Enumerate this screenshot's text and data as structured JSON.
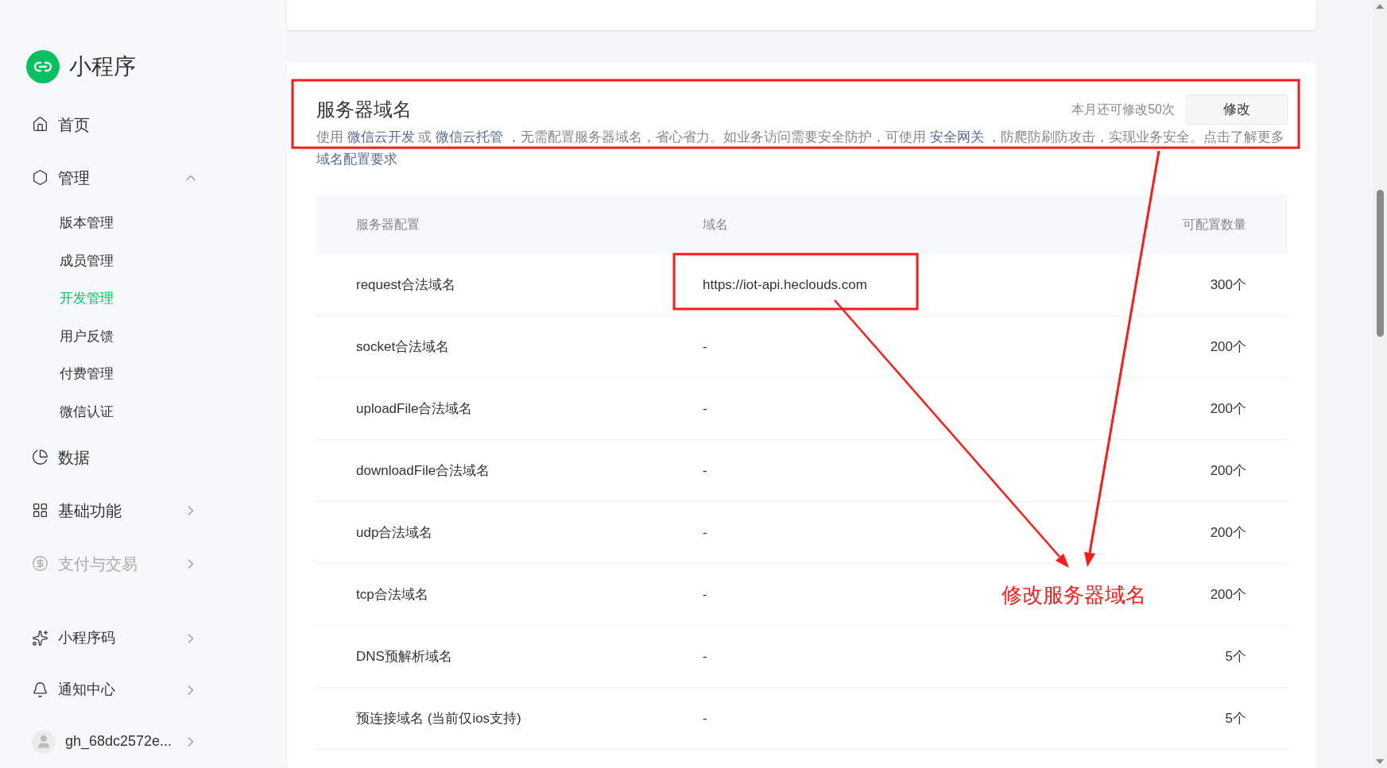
{
  "sidebar": {
    "logo": {
      "title": "小程序"
    },
    "menu": [
      {
        "kind": "link",
        "label": "首页",
        "disabled": false
      },
      {
        "kind": "group",
        "label": "管理",
        "expanded": true,
        "disabled": false,
        "children": [
          {
            "label": "版本管理",
            "selected": false
          },
          {
            "label": "成员管理",
            "selected": false
          },
          {
            "label": "开发管理",
            "selected": true
          },
          {
            "label": "用户反馈",
            "selected": false
          },
          {
            "label": "付费管理",
            "selected": false
          },
          {
            "label": "微信认证",
            "selected": false
          }
        ]
      },
      {
        "kind": "link",
        "label": "数据",
        "disabled": false
      },
      {
        "kind": "group",
        "label": "基础功能",
        "expanded": false,
        "disabled": false
      },
      {
        "kind": "group",
        "label": "支付与交易",
        "expanded": false,
        "disabled": true
      }
    ],
    "footer": [
      {
        "kind": "group",
        "label": "小程序码",
        "expanded": false
      },
      {
        "kind": "group",
        "label": "通知中心",
        "expanded": false
      },
      {
        "kind": "account",
        "label": "gh_68dc2572e...",
        "expanded": false
      }
    ]
  },
  "domain_section": {
    "title": "服务器域名",
    "quota_note": "本月还可修改50次",
    "edit_button": "修改",
    "description": [
      {
        "text": "使用 ",
        "link": false
      },
      {
        "text": "微信云开发",
        "link": true
      },
      {
        "text": " 或 ",
        "link": false
      },
      {
        "text": "微信云托管",
        "link": true
      },
      {
        "text": " ，无需配置服务器域名，省心省力。如业务访问需要安全防护，可使用 ",
        "link": false
      },
      {
        "text": "安全网关",
        "link": true
      },
      {
        "text": " ，防爬防刷防攻击，实现业务安全。点击了解更多 ",
        "link": false
      },
      {
        "text": "域名配置要求",
        "link": true
      }
    ],
    "table": {
      "columns": [
        "服务器配置",
        "域名",
        "可配置数量"
      ],
      "rows": [
        {
          "config": "request合法域名",
          "domain": "https://iot-api.heclouds.com",
          "quota": "300个"
        },
        {
          "config": "socket合法域名",
          "domain": "-",
          "quota": "200个"
        },
        {
          "config": "uploadFile合法域名",
          "domain": "-",
          "quota": "200个"
        },
        {
          "config": "downloadFile合法域名",
          "domain": "-",
          "quota": "200个"
        },
        {
          "config": "udp合法域名",
          "domain": "-",
          "quota": "200个"
        },
        {
          "config": "tcp合法域名",
          "domain": "-",
          "quota": "200个"
        },
        {
          "config": "DNS预解析域名",
          "domain": "-",
          "quota": "5个"
        },
        {
          "config": "预连接域名 (当前仅ios支持)",
          "domain": "-",
          "quota": "5个"
        }
      ]
    }
  },
  "annotation": {
    "label": "修改服务器域名"
  }
}
